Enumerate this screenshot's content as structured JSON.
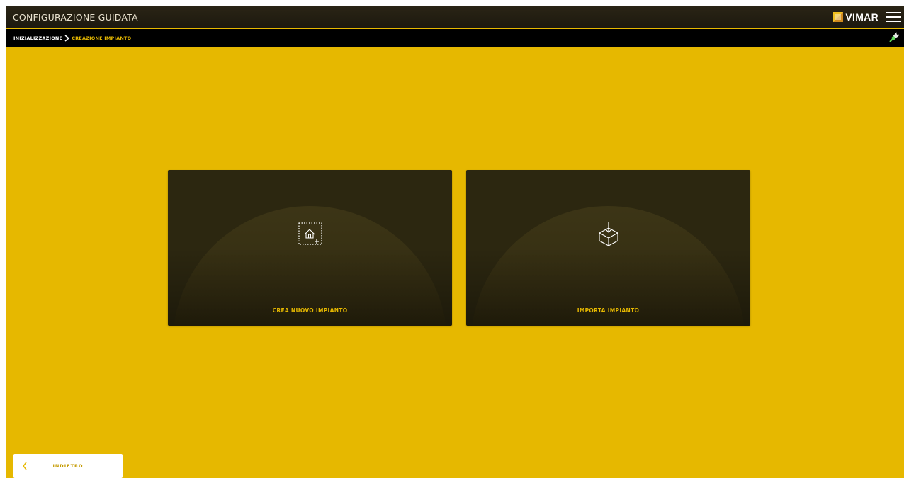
{
  "header": {
    "title": "CONFIGURAZIONE GUIDATA",
    "brand": "VIMAR",
    "icons": {
      "logo": "vimar-logo",
      "menu": "hamburger-menu-icon"
    }
  },
  "breadcrumb": {
    "items": [
      "INIZIALIZZAZIONE",
      "CREAZIONE IMPIANTO"
    ],
    "separator_icon": "chevron-right-icon",
    "status_icon": "plug-connection-icon"
  },
  "options": [
    {
      "label": "CREA NUOVO IMPIANTO",
      "icon": "add-house-icon"
    },
    {
      "label": "IMPORTA IMPIANTO",
      "icon": "import-box-icon"
    }
  ],
  "footer": {
    "back_label": "INDIETRO",
    "back_icon": "chevron-left-icon"
  },
  "colors": {
    "accent": "#e6b800",
    "header_bg": "#231f12",
    "breadcrumb_bg": "#000000",
    "card_bg": "#2c2710",
    "back_button_bg": "#ffffff"
  }
}
